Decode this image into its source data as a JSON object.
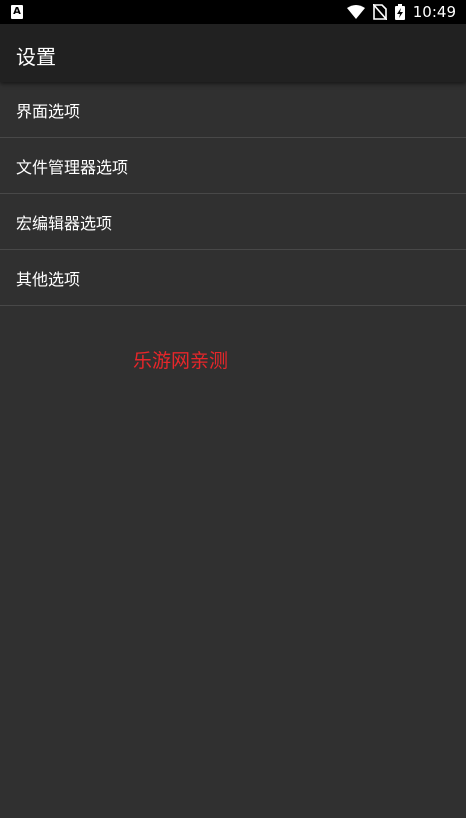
{
  "status_bar": {
    "time": "10:49"
  },
  "app_bar": {
    "title": "设置"
  },
  "settings": [
    {
      "label": "界面选项"
    },
    {
      "label": "文件管理器选项"
    },
    {
      "label": "宏编辑器选项"
    },
    {
      "label": "其他选项"
    }
  ],
  "watermark": "乐游网亲测",
  "colors": {
    "background": "#303030",
    "app_bar": "#212121",
    "status_bar": "#000000",
    "divider": "#484848",
    "watermark": "#e8262a"
  }
}
